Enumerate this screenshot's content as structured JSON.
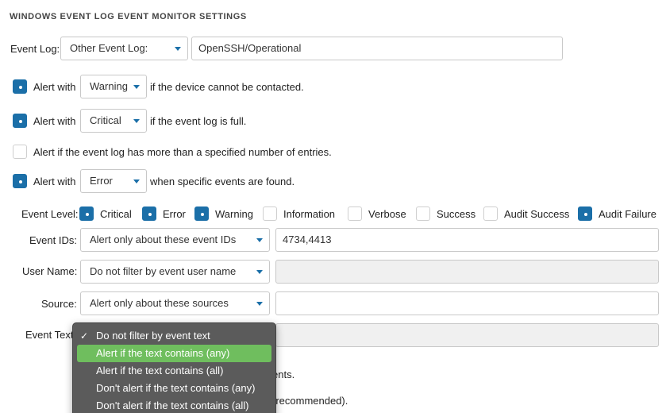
{
  "title": "WINDOWS EVENT LOG EVENT MONITOR SETTINGS",
  "event_log": {
    "label": "Event Log:",
    "select_value": "Other Event Log:",
    "input_value": "OpenSSH/Operational"
  },
  "alerts": {
    "alert_with": "Alert with",
    "contact": {
      "severity": "Warning",
      "suffix": "if the device cannot be contacted."
    },
    "full": {
      "severity": "Critical",
      "suffix": "if the event log is full."
    },
    "entries_text": "Alert if the event log has more than a specified number of entries.",
    "events": {
      "severity": "Error",
      "suffix": "when specific events are found."
    }
  },
  "event_level": {
    "label": "Event Level:",
    "items": [
      {
        "label": "Critical",
        "checked": true
      },
      {
        "label": "Error",
        "checked": true
      },
      {
        "label": "Warning",
        "checked": true
      },
      {
        "label": "Information",
        "checked": false
      },
      {
        "label": "Verbose",
        "checked": false
      },
      {
        "label": "Success",
        "checked": false
      },
      {
        "label": "Audit Success",
        "checked": false
      },
      {
        "label": "Audit Failure",
        "checked": true
      }
    ]
  },
  "event_ids": {
    "label": "Event IDs:",
    "select_value": "Alert only about these event IDs",
    "input_value": "4734,4413"
  },
  "user_name": {
    "label": "User Name:",
    "select_value": "Do not filter by event user name",
    "input_value": ""
  },
  "source": {
    "label": "Source:",
    "select_value": "Alert only about these sources",
    "input_value": ""
  },
  "event_text": {
    "label": "Event Text"
  },
  "hidden_text": {
    "line1": "ents.",
    "line2": "(recommended)."
  },
  "dropdown": {
    "options": [
      {
        "label": "Do not filter by event text",
        "checked": true,
        "active": false
      },
      {
        "label": "Alert if the text contains (any)",
        "checked": false,
        "active": true
      },
      {
        "label": "Alert if the text contains (all)",
        "checked": false,
        "active": false
      },
      {
        "label": "Don't alert if the text contains (any)",
        "checked": false,
        "active": false
      },
      {
        "label": "Don't alert if the text contains (all)",
        "checked": false,
        "active": false
      }
    ]
  },
  "colors": {
    "accent": "#1b6fa8",
    "highlight": "#6fbe5e",
    "menu_bg": "#5b5b5b"
  }
}
